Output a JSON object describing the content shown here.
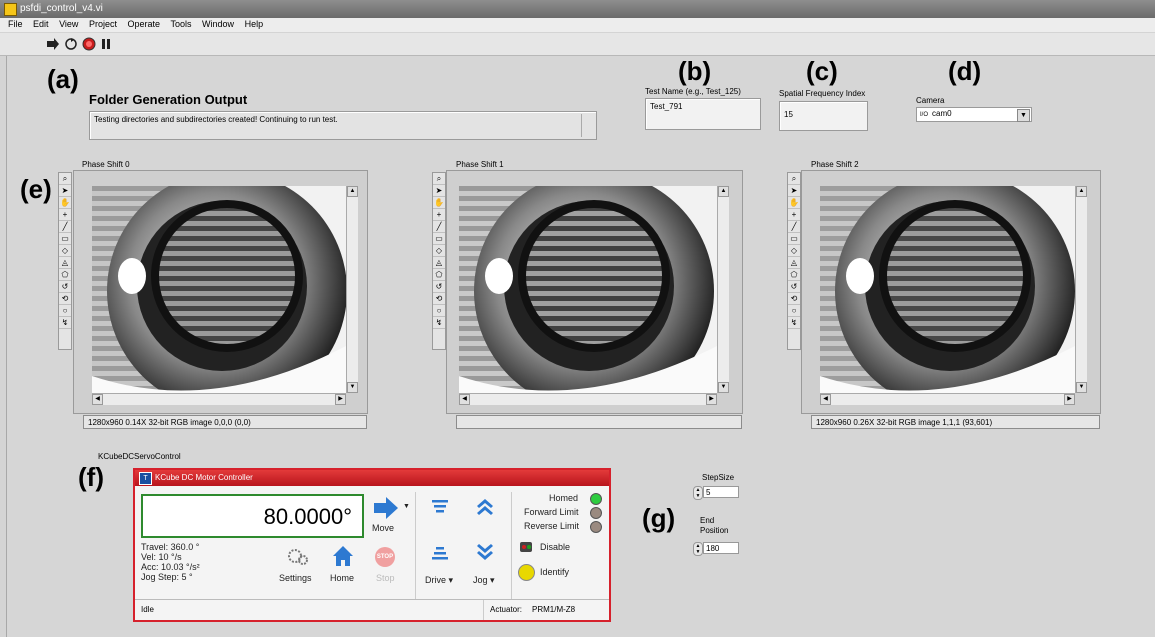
{
  "window": {
    "title": "psfdi_control_v4.vi"
  },
  "menu": [
    "File",
    "Edit",
    "View",
    "Project",
    "Operate",
    "Tools",
    "Window",
    "Help"
  ],
  "annotations": {
    "a": "(a)",
    "b": "(b)",
    "c": "(c)",
    "d": "(d)",
    "e": "(e)",
    "f": "(f)",
    "g": "(g)"
  },
  "folder": {
    "heading": "Folder Generation Output",
    "message": "Testing directories and subdirectories created! Continuing to run test."
  },
  "test_name": {
    "label": "Test Name (e.g., Test_125)",
    "value": "Test_791"
  },
  "spatial_freq": {
    "label": "Spatial Frequency Index",
    "value": "15"
  },
  "camera": {
    "label": "Camera",
    "value": "cam0"
  },
  "images": [
    {
      "label": "Phase Shift 0",
      "status": "1280x960 0.14X 32-bit RGB image 0,0,0    (0,0)"
    },
    {
      "label": "Phase Shift 1",
      "status": ""
    },
    {
      "label": "Phase Shift 2",
      "status": "1280x960 0.26X 32-bit RGB image 1,1,1    (93,601)"
    }
  ],
  "kcube": {
    "section_label": "KCubeDCServoControl",
    "title": "KCube DC Motor Controller",
    "position": "80.0000°",
    "move_label": "Move",
    "travel": "Travel: 360.0 °",
    "vel": "Vel: 10 °/s",
    "acc": "Acc: 10.03 °/s²",
    "jog_step": "Jog Step: 5 °",
    "settings_label": "Settings",
    "home_label": "Home",
    "stop_label": "Stop",
    "stop_icon_text": "STOP",
    "drive_label": "Drive",
    "jog_label": "Jog",
    "homed_label": "Homed",
    "fwd_limit_label": "Forward Limit",
    "rev_limit_label": "Reverse Limit",
    "disable_label": "Disable",
    "identify_label": "Identify",
    "status": "Idle",
    "actuator_label": "Actuator:",
    "actuator_value": "PRM1/M-Z8",
    "colors": {
      "accent": "#d6212c",
      "homed_led": "#2ecc40",
      "off_led": "#9a8a80",
      "identify": "#e8d800"
    }
  },
  "step_size": {
    "label": "StepSize",
    "value": "5"
  },
  "end_position": {
    "label": "End Position",
    "value": "180"
  }
}
